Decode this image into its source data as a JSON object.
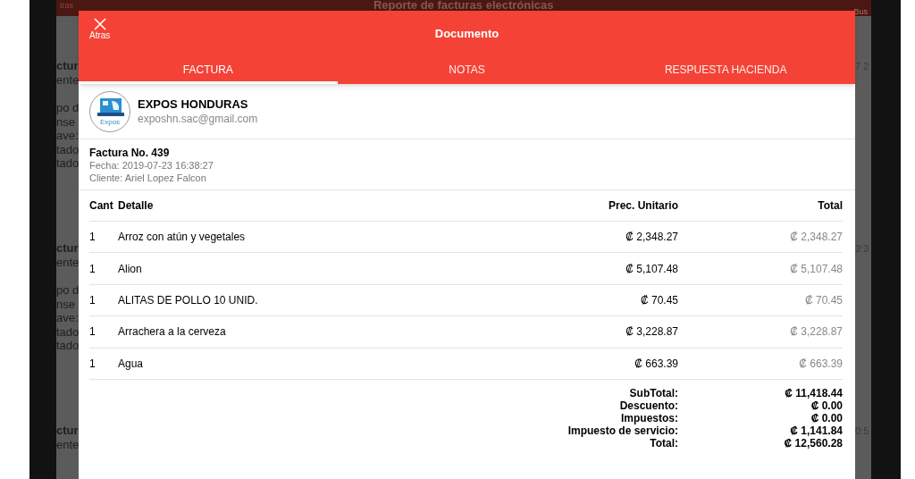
{
  "background": {
    "back_label": "tras",
    "title": "Reporte de facturas electrónicas",
    "search_label": "Bus",
    "cards": [
      {
        "lines": [
          "ctur",
          "ente",
          "po d",
          "nse",
          "ave:",
          "tado",
          "tado"
        ],
        "right": "7 2"
      },
      {
        "lines": [
          "ctur",
          "ente",
          "po d",
          "nse",
          "ave:",
          "tado",
          "tado"
        ],
        "right": "3:3"
      },
      {
        "lines": [
          "ctur",
          "ente"
        ],
        "right": "0:5"
      }
    ]
  },
  "dialog": {
    "close_label": "Atras",
    "title": "Documento",
    "tabs": [
      {
        "label": "FACTURA",
        "selected": true
      },
      {
        "label": "NOTAS",
        "selected": false
      },
      {
        "label": "RESPUESTA HACIENDA",
        "selected": false
      }
    ],
    "company": {
      "logo_text": "Expos",
      "name": "EXPOS HONDURAS",
      "email": "exposhn.sac@gmail.com"
    },
    "invoice": {
      "number": "Factura No. 439",
      "date": "Fecha: 2019-07-23 16:38:27",
      "client": "Cliente: Ariel Lopez Falcon"
    },
    "table": {
      "columns": [
        "Cant",
        "Detalle",
        "Prec. Unitario",
        "Total"
      ],
      "rows": [
        [
          "1",
          "Arroz con atún y vegetales",
          "₡ 2,348.27",
          "₡ 2,348.27"
        ],
        [
          "1",
          "Alion",
          "₡ 5,107.48",
          "₡ 5,107.48"
        ],
        [
          "1",
          "ALITAS DE POLLO 10 UNID.",
          "₡ 70.45",
          "₡ 70.45"
        ],
        [
          "1",
          "Arrachera a la cerveza",
          "₡ 3,228.87",
          "₡ 3,228.87"
        ],
        [
          "1",
          "Agua",
          "₡ 663.39",
          "₡ 663.39"
        ]
      ]
    },
    "totals": [
      {
        "label": "SubTotal:",
        "value": "₡ 11,418.44"
      },
      {
        "label": "Descuento:",
        "value": "₡ 0.00"
      },
      {
        "label": "Impuestos:",
        "value": "₡ 0.00"
      },
      {
        "label": "Impuesto de servicio:",
        "value": "₡ 1,141.84"
      },
      {
        "label": "Total:",
        "value": "₡ 12,560.28"
      }
    ]
  }
}
